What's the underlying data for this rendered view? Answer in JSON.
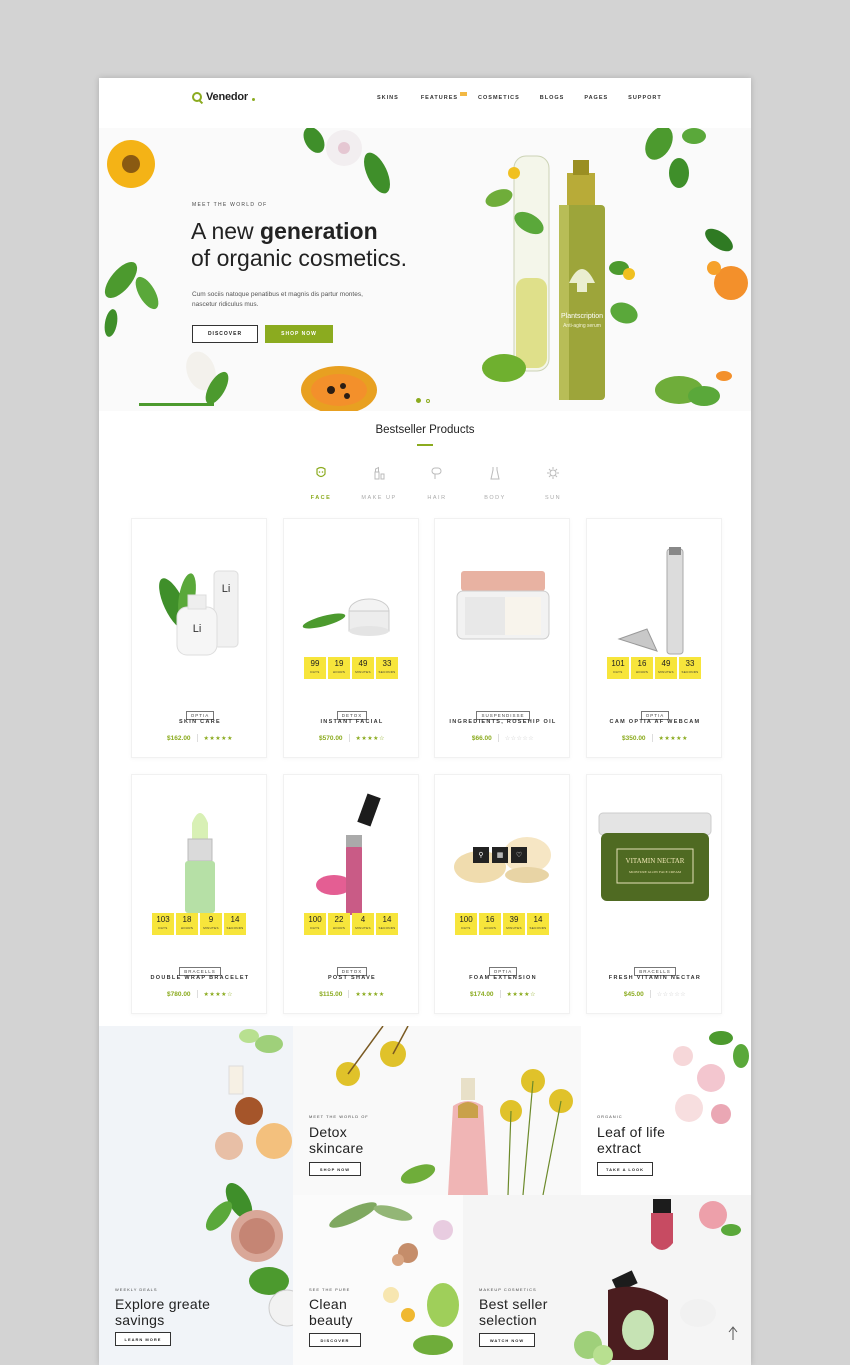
{
  "header": {
    "logo": "Venedor",
    "nav": [
      "SKINS",
      "FEATURES",
      "COSMETICS",
      "BLOGS",
      "PAGES",
      "SUPPORT"
    ]
  },
  "hero": {
    "eyebrow": "MEET THE WORLD OF",
    "title_pre": "A new ",
    "title_bold": "generation",
    "title_line2": "of organic cosmetics.",
    "description": "Cum sociis natoque penatibus et magnis dis partur montes, nascetur ridiculus mus.",
    "btn_discover": "DISCOVER",
    "btn_shop": "SHOP NOW",
    "bottle_label": "Plantscription",
    "bottle_sub": "Anti-aging serum"
  },
  "bestseller": {
    "title": "Bestseller Products",
    "categories": [
      "FACE",
      "MAKE UP",
      "HAIR",
      "BODY",
      "SUN"
    ]
  },
  "timer_labels": [
    "DAYS",
    "HOURS",
    "MINUTES",
    "SECONDS"
  ],
  "products": [
    {
      "brand": "OPTIA",
      "name": "SKIN CARE",
      "price": "$162.00",
      "rating": "★★★★★",
      "timer": null
    },
    {
      "brand": "DETOX",
      "name": "INSTANT FACIAL",
      "price": "$570.00",
      "rating": "★★★★☆",
      "timer": [
        "99",
        "19",
        "49",
        "33"
      ]
    },
    {
      "brand": "SUSPENDISSE",
      "name": "INGREDIENTS, ROSEHIP OIL",
      "price": "$66.00",
      "rating": "☆☆☆☆☆",
      "timer": null
    },
    {
      "brand": "OPTIA",
      "name": "CAM OPTIA AF WEBCAM",
      "price": "$350.00",
      "rating": "★★★★★",
      "timer": [
        "101",
        "16",
        "49",
        "33"
      ]
    },
    {
      "brand": "BRACELLS",
      "name": "DOUBLE WRAP BRACELET",
      "price": "$780.00",
      "rating": "★★★★☆",
      "timer": [
        "103",
        "18",
        "9",
        "14"
      ]
    },
    {
      "brand": "DETOX",
      "name": "POST SHAVE",
      "price": "$115.00",
      "rating": "★★★★★",
      "timer": [
        "100",
        "22",
        "4",
        "14"
      ]
    },
    {
      "brand": "OPTIA",
      "name": "FOAM EXTENSION",
      "price": "$174.00",
      "rating": "★★★★☆",
      "timer": [
        "100",
        "16",
        "39",
        "14"
      ]
    },
    {
      "brand": "BRACELLS",
      "name": "FRESH VITAMIN NECTAR",
      "price": "$45.00",
      "rating": "☆☆☆☆☆",
      "timer": null
    }
  ],
  "jar_label": "VITAMIN NECTAR",
  "jar_sub": "MOISTURE GLOW FACE CREAM",
  "banners": {
    "detox": {
      "eyebrow": "MEET THE WORLD OF",
      "title1": "Detox",
      "title2": "skincare",
      "button": "SHOP NOW"
    },
    "leaf": {
      "eyebrow": "ORGANIC",
      "title1": "Leaf of life",
      "title2": "extract",
      "button": "TAKE A LOOK"
    },
    "explore": {
      "eyebrow": "WEEKLY DEALS",
      "title1": "Explore greate",
      "title2": "savings",
      "button": "LEARN MORE"
    },
    "clean": {
      "eyebrow": "SEE THE PURE",
      "title1": "Clean",
      "title2": "beauty",
      "button": "DISCOVER"
    },
    "best": {
      "eyebrow": "MAKEUP COSMETICS",
      "title1": "Best seller",
      "title2": "selection",
      "button": "WATCH NOW"
    }
  },
  "colors": {
    "accent": "#8bab1f",
    "timer": "#f7e53b",
    "page_bg": "#d3d3d3"
  }
}
